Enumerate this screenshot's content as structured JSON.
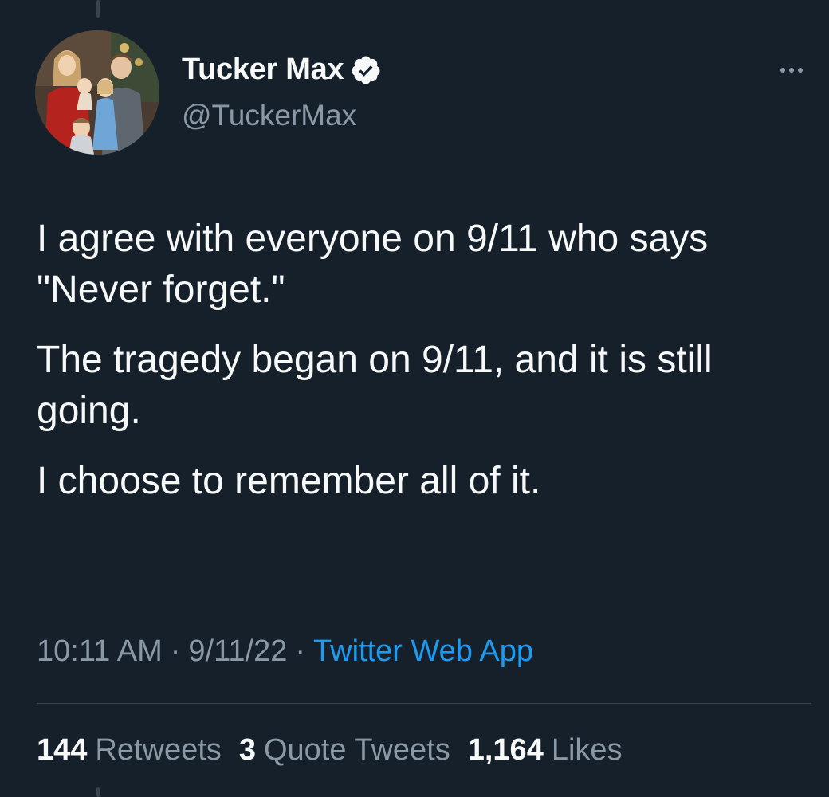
{
  "tweet": {
    "author": {
      "name": "Tucker Max",
      "handle": "@TuckerMax",
      "verified": true,
      "avatar_icon": "family-photo-avatar"
    },
    "paragraphs": [
      "I agree with everyone on 9/11 who says \"Never forget.\"",
      "The tragedy began on 9/11, and it is still going.",
      "I choose to remember all of it."
    ],
    "time": "10:11 AM",
    "date": "9/11/22",
    "source": "Twitter Web App",
    "separator": "·",
    "stats": {
      "retweets_count": "144",
      "retweets_label": "Retweets",
      "quotes_count": "3",
      "quotes_label": "Quote Tweets",
      "likes_count": "1,164",
      "likes_label": "Likes"
    }
  },
  "colors": {
    "background": "#15202b",
    "text_primary": "#f7f9f9",
    "text_secondary": "#8b98a5",
    "link": "#1d9bf0",
    "divider": "#38444d"
  }
}
